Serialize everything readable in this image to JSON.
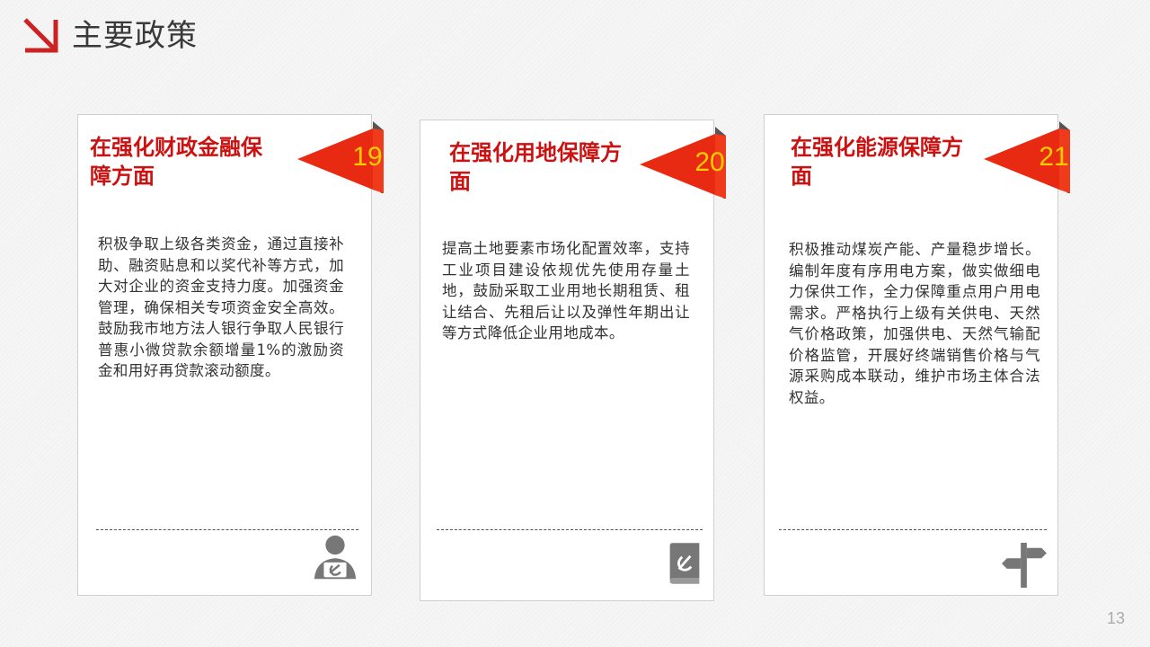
{
  "header": {
    "title": "主要政策",
    "icon": "arrow-down-right-icon",
    "accent_color": "#cc2222"
  },
  "cards": [
    {
      "number": "19",
      "title": "在强化财政金融保障方面",
      "body": "积极争取上级各类资金，通过直接补助、融资贴息和以奖代补等方式，加大对企业的资金支持力度。加强资金管理，确保相关专项资金安全高效。鼓励我市地方法人银行争取人民银行普惠小微贷款余额增量1%的激励资金和用好再贷款滚动额度。",
      "icon": "person-with-party-emblem-icon"
    },
    {
      "number": "20",
      "title": "在强化用地保障方面",
      "body": "提高土地要素市场化配置效率，支持工业项目建设依规优先使用存量土地，鼓励采取工业用地长期租赁、租让结合、先租后让以及弹性年期出让等方式降低企业用地成本。",
      "icon": "party-emblem-book-icon"
    },
    {
      "number": "21",
      "title": "在强化能源保障方面",
      "body": "积极推动煤炭产能、产量稳步增长。编制年度有序用电方案，做实做细电力保供工作，全力保障重点用户用电需求。严格执行上级有关供电、天然气价格政策，加强供电、天然气输配价格监管，开展好终端销售价格与气源采购成本联动，维护市场主体合法权益。",
      "icon": "signpost-icon"
    }
  ],
  "colors": {
    "title_red": "#cc1111",
    "badge_red": "#e82a12",
    "badge_number": "#ffcc00",
    "body_text": "#333333"
  },
  "page_number": "13"
}
